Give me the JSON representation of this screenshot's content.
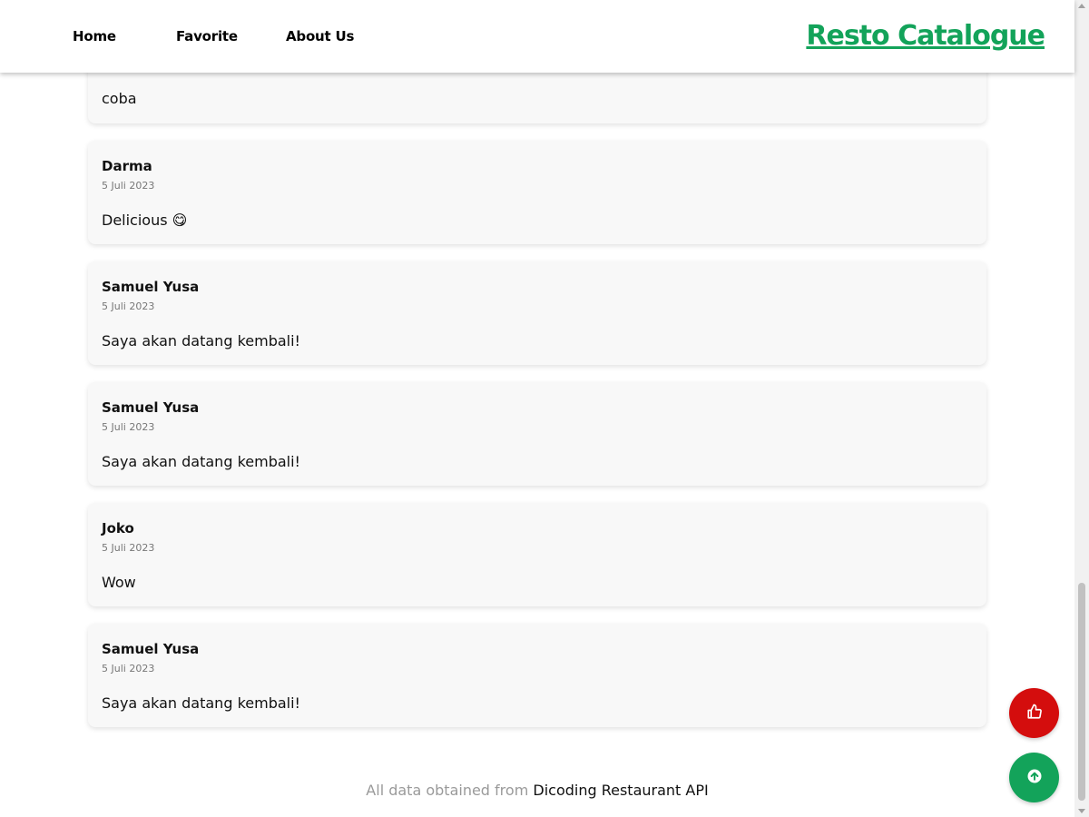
{
  "nav": {
    "home": "Home",
    "favorite": "Favorite",
    "about": "About Us",
    "brand": "Resto Catalogue"
  },
  "reviews": [
    {
      "name": "",
      "date": "",
      "text": "coba"
    },
    {
      "name": "Darma",
      "date": "5 Juli 2023",
      "text": "Delicious 😋"
    },
    {
      "name": "Samuel Yusa",
      "date": "5 Juli 2023",
      "text": "Saya akan datang kembali!"
    },
    {
      "name": "Samuel Yusa",
      "date": "5 Juli 2023",
      "text": "Saya akan datang kembali!"
    },
    {
      "name": "Joko",
      "date": "5 Juli 2023",
      "text": "Wow"
    },
    {
      "name": "Samuel Yusa",
      "date": "5 Juli 2023",
      "text": "Saya akan datang kembali!"
    }
  ],
  "footer": {
    "prefix": "All data obtained from",
    "link": "Dicoding Restaurant API"
  },
  "buttons": {
    "like_icon": "thumbs-up-icon",
    "top_icon": "arrow-up-circle-icon"
  },
  "colors": {
    "brand": "#13a35a",
    "like": "#d40d0d",
    "scroll_top": "#13a35a"
  }
}
